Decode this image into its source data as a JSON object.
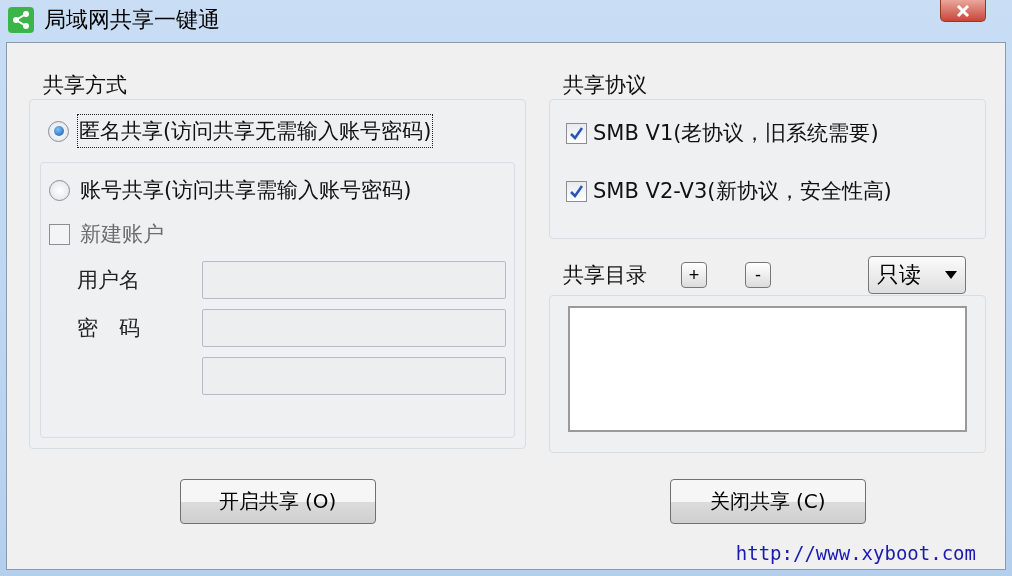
{
  "window": {
    "title": "局域网共享一键通"
  },
  "share_mode": {
    "title": "共享方式",
    "options": [
      {
        "label": "匿名共享(访问共享无需输入账号密码)",
        "selected": true
      },
      {
        "label": "账号共享(访问共享需输入账号密码)",
        "selected": false
      }
    ],
    "new_account": {
      "label": "新建账户",
      "checked": false,
      "disabled": true
    },
    "fields": [
      {
        "label": "用户名",
        "disabled": true
      },
      {
        "label": "密　码",
        "disabled": true
      },
      {
        "disabled": true
      }
    ]
  },
  "protocol": {
    "title": "共享协议",
    "options": [
      {
        "label": "SMB V1(老协议，旧系统需要)",
        "checked": true
      },
      {
        "label": "SMB V2-V3(新协议，安全性高)",
        "checked": true
      }
    ]
  },
  "directory": {
    "title": "共享目录",
    "add_button": "+",
    "remove_button": "-",
    "permission": "只读"
  },
  "buttons": [
    {
      "label": "开启共享 (O)"
    },
    {
      "label": "关闭共享 (C)"
    }
  ],
  "link": "http://www.xyboot.com"
}
